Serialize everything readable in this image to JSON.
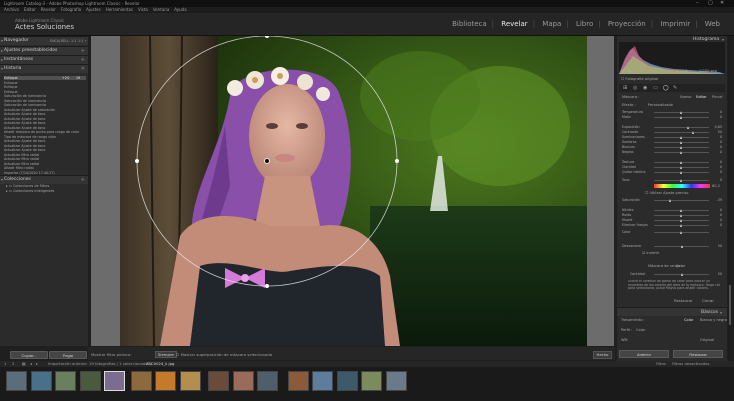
{
  "window": {
    "title": "Lightroom Catalog-3 - Adobe Photoshop Lightroom Classic - Revelar",
    "controls": [
      "–",
      "▢",
      "✕"
    ]
  },
  "menu": [
    "Archivo",
    "Editar",
    "Revelar",
    "Fotografía",
    "Ajustes",
    "Herramientas",
    "Vista",
    "Ventana",
    "Ayuda"
  ],
  "identity": {
    "line1": "Adobe Lightroom Classic",
    "line2": "Actes Soluciones"
  },
  "modules": {
    "items": [
      "Biblioteca",
      "Revelar",
      "Mapa",
      "Libro",
      "Proyección",
      "Imprimir",
      "Web"
    ],
    "active": "Revelar"
  },
  "left_panel": {
    "navigator": {
      "title": "Navegador",
      "zoom": [
        "ENCAJ",
        "RELL.",
        "1:1",
        "1:1 ÷"
      ]
    },
    "presets": {
      "title": "Ajustes preestablecidos"
    },
    "snapshots": {
      "title": "Instantáneas"
    },
    "history": {
      "title": "Historia",
      "items": [
        {
          "label": "Enfoque",
          "value": "+24",
          "value2": "19",
          "selected": true
        },
        {
          "label": "Enfoque"
        },
        {
          "label": "Enfoque"
        },
        {
          "label": "Enfoque"
        },
        {
          "label": "Saturación de luminancia"
        },
        {
          "label": "Saturación de luminancia"
        },
        {
          "label": "Saturación de luminancia"
        },
        {
          "label": "Actualizar Ajuste de saturación"
        },
        {
          "label": "Actualizar Ajuste de tono"
        },
        {
          "label": "Actualizar Ajuste de tono"
        },
        {
          "label": "Actualizar Ajuste de tono"
        },
        {
          "label": "Actualizar Ajuste de tono"
        },
        {
          "label": "Añadir máscara de punto para rango de color"
        },
        {
          "label": "Tipo de máscara de rango color"
        },
        {
          "label": "Actualizar Ajuste de tono"
        },
        {
          "label": "Actualizar Ajuste de tono"
        },
        {
          "label": "Actualizar Ajuste de tono"
        },
        {
          "label": "Actualizar filtro radial"
        },
        {
          "label": "Actualizar filtro radial"
        },
        {
          "label": "Actualizar filtro radial"
        },
        {
          "label": "Añadir filtro radial"
        },
        {
          "label": "Importar (7/10/2020 17:40:27)"
        }
      ]
    },
    "collections": {
      "title": "Colecciones",
      "items": [
        "Colecciones de filtros",
        "Colecciones inteligentes"
      ]
    },
    "copy_button": "Copiar...",
    "paste_button": "Pegar"
  },
  "toolbar": {
    "overlay_label": "Mostrar filtro pintura:",
    "overlay_value": "Siempre",
    "mask_option": "Mostrar superposición de máscara seleccionada",
    "done_button": "Hecho"
  },
  "right_panel": {
    "histogram": {
      "title": "Histograma",
      "info": [
        "ISO 100",
        "55 mm",
        "f / 2,8",
        "1/250 seg"
      ],
      "original_label": "Fotografía original"
    },
    "mask": {
      "label": "Máscara :",
      "options": [
        "Nuevo",
        "Editar",
        "Pincel"
      ]
    },
    "effect": {
      "label": "Efecto :",
      "value": "Personalizado"
    },
    "sliders": [
      {
        "label": "Temperatura",
        "pos": 0.5,
        "value": "0"
      },
      {
        "label": "Matiz",
        "pos": 0.5,
        "value": "0"
      },
      {
        "label": "Exposición",
        "pos": 0.62,
        "value": "0,65"
      },
      {
        "label": "Contraste",
        "pos": 0.72,
        "value": "50"
      },
      {
        "label": "Iluminaciones",
        "pos": 0.5,
        "value": "0"
      },
      {
        "label": "Sombras",
        "pos": 0.5,
        "value": "0"
      },
      {
        "label": "Blancos",
        "pos": 0.5,
        "value": "0"
      },
      {
        "label": "Negros",
        "pos": 0.5,
        "value": "0"
      },
      {
        "label": "Textura",
        "pos": 0.5,
        "value": "0"
      },
      {
        "label": "Claridad",
        "pos": 0.5,
        "value": "0"
      },
      {
        "label": "Quitar neblina",
        "pos": 0.5,
        "value": "0"
      },
      {
        "label": "Tono",
        "pos": 0.5,
        "value": "0"
      },
      {
        "label": "Saturación",
        "pos": 0.3,
        "value": "- 59"
      },
      {
        "label": "Nitidez",
        "pos": 0.5,
        "value": "0"
      },
      {
        "label": "Ruido",
        "pos": 0.5,
        "value": "0"
      },
      {
        "label": "Muaré",
        "pos": 0.5,
        "value": "0"
      },
      {
        "label": "Eliminar franjas",
        "pos": 0.5,
        "value": "0"
      },
      {
        "label": "Color",
        "pos": 0.5,
        "value": ""
      }
    ],
    "hue_value": "60,2",
    "fine_adjust": "Utilizar Ajuste preciso",
    "feather": {
      "label": "Desvanecer",
      "value": "50"
    },
    "invert": "Invertir",
    "range_mask": {
      "label": "Máscara de rango :",
      "value": "Color"
    },
    "amount": {
      "label": "Cantidad",
      "value": "50"
    },
    "range_help": "Utilice el Selector de gama de color para indicar un muestreo de los colores del área de la máscara. Haga clic para seleccionar, pulse Mayús para añadir colores.",
    "reset_button": "Restaurar",
    "close_button": "Cerrar",
    "basic": {
      "title": "Básicos",
      "treatment": "Tratamiento :",
      "color": "Color",
      "bw": "Blanco y negro",
      "profile": "Perfil :",
      "profile_value": "Color",
      "wb": "WB:",
      "wb_value": "Original"
    },
    "prev_button": "Anterior",
    "restore_button": "Restaurar"
  },
  "filmstrip": {
    "header": [
      "1",
      "2",
      "Importación anterior",
      "19 fotografías / 1 seleccionadas /",
      "ZSC0024_ll.jpg"
    ],
    "filter_label": "Filtro:",
    "filter_value": "Filtros desactivados",
    "thumb_count": 16,
    "selected_index": 4
  },
  "colors": {
    "panel": "#2b2b2b",
    "panel_header": "#343434",
    "canvas": "#6c6c6c",
    "accent_active": "#e8e8e8",
    "history_selected": "#505050"
  }
}
